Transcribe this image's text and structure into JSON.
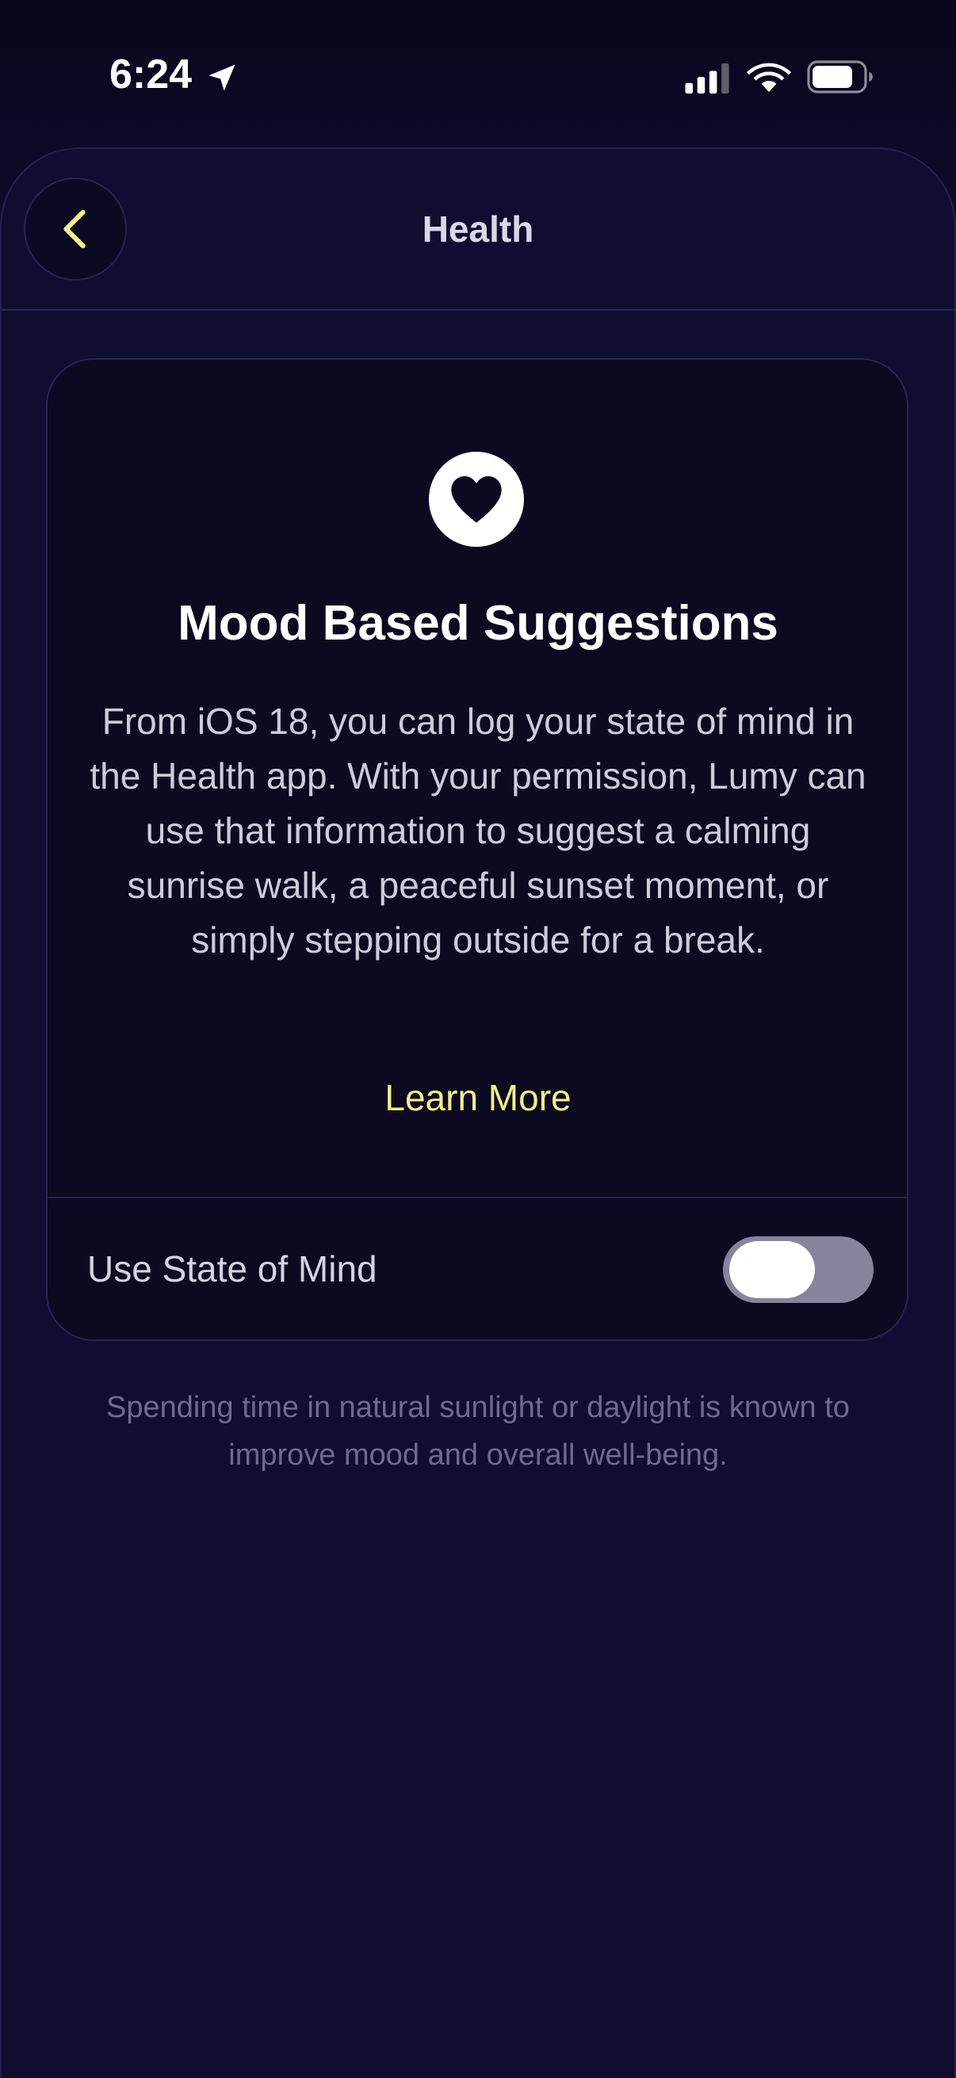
{
  "status_bar": {
    "time": "6:24",
    "icons": [
      "location-arrow-icon",
      "cellular-signal-icon",
      "wifi-icon",
      "battery-icon"
    ]
  },
  "nav": {
    "back_icon": "chevron-left-icon",
    "title": "Health"
  },
  "card": {
    "icon": "heart-icon",
    "title": "Mood Based Suggestions",
    "body": "From iOS 18, you can log your state of mind in the Health app. With your permission, Lumy can use that information to suggest a calming sunrise walk, a peaceful sunset moment, or simply stepping outside for a break.",
    "link_label": "Learn More",
    "toggle": {
      "label": "Use State of Mind",
      "state": "off"
    }
  },
  "footer_note": "Spending time in natural sunlight or daylight is known to improve mood and overall well-being.",
  "colors": {
    "background": "#100e30",
    "card": "#0b0a20",
    "accent": "#f3ee8c",
    "toggle_off": "#87859e"
  }
}
